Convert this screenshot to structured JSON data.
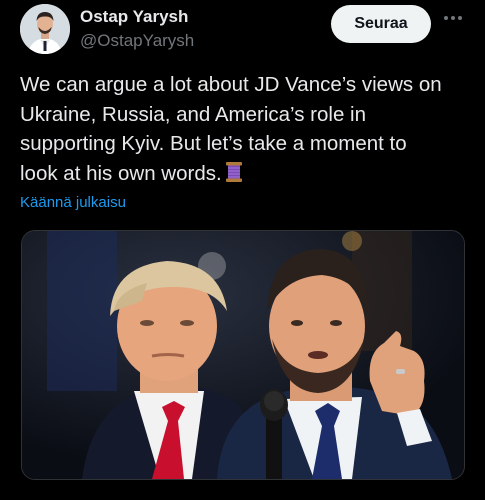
{
  "author": {
    "display_name": "Ostap Yarysh",
    "handle": "@OstapYarysh"
  },
  "actions": {
    "follow_label": "Seuraa",
    "more_icon": "more-dots-icon"
  },
  "tweet": {
    "text": "We can argue a lot about JD Vance’s views on\nUkraine, Russia, and America’s role in\nsupporting Kyiv. But let’s take a moment to\nlook at his own words.",
    "emoji_icon": "spool-of-thread-emoji-icon",
    "translate_label": "Käännä julkaisu"
  },
  "media": {
    "type": "photo"
  },
  "colors": {
    "background": "#000000",
    "text_primary": "#e7e9ea",
    "text_secondary": "#71767b",
    "link": "#1d9bf0",
    "button_bg": "#eff3f4",
    "button_text": "#0f1419"
  }
}
